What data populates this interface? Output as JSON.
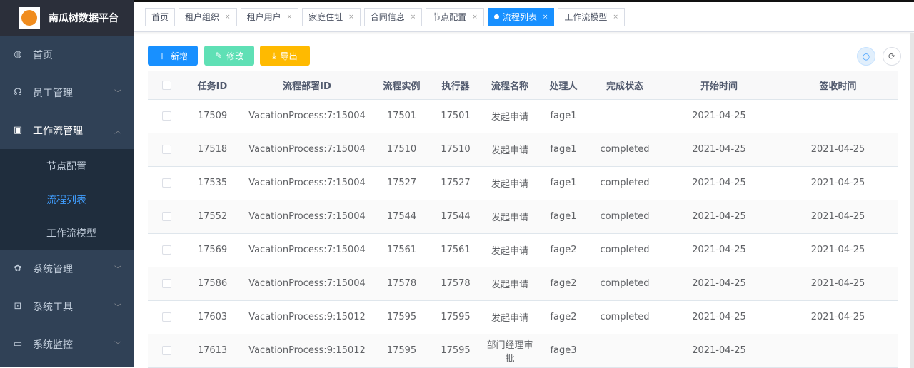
{
  "app": {
    "title": "南瓜树数据平台"
  },
  "sidebar": {
    "items": [
      {
        "label": "首页",
        "icon": "dashboard-icon",
        "expandable": false
      },
      {
        "label": "员工管理",
        "icon": "user-group-icon",
        "expandable": true
      },
      {
        "label": "工作流管理",
        "icon": "workflow-icon",
        "expandable": true,
        "expanded": true,
        "children": [
          {
            "label": "节点配置"
          },
          {
            "label": "流程列表",
            "active": true
          },
          {
            "label": "工作流模型"
          }
        ]
      },
      {
        "label": "系统管理",
        "icon": "gear-icon",
        "expandable": true
      },
      {
        "label": "系统工具",
        "icon": "toolbox-icon",
        "expandable": true
      },
      {
        "label": "系统监控",
        "icon": "monitor-icon",
        "expandable": true
      }
    ]
  },
  "tabs": [
    {
      "label": "首页"
    },
    {
      "label": "租户组织"
    },
    {
      "label": "租户用户"
    },
    {
      "label": "家庭住址"
    },
    {
      "label": "合同信息"
    },
    {
      "label": "节点配置"
    },
    {
      "label": "流程列表",
      "active": true
    },
    {
      "label": "工作流模型"
    }
  ],
  "toolbar": {
    "add": "新增",
    "edit": "修改",
    "export": "导出",
    "colors": {
      "add": "#1890ff",
      "edit": "#5fe0b5",
      "export": "#ffba00"
    }
  },
  "table": {
    "headers": [
      "任务ID",
      "流程部署ID",
      "流程实例",
      "执行器",
      "流程名称",
      "处理人",
      "完成状态",
      "开始时间",
      "签收时间"
    ],
    "rows": [
      [
        "17509",
        "VacationProcess:7:15004",
        "17501",
        "17501",
        "发起申请",
        "fage1",
        "",
        "2021-04-25",
        ""
      ],
      [
        "17518",
        "VacationProcess:7:15004",
        "17510",
        "17510",
        "发起申请",
        "fage1",
        "completed",
        "2021-04-25",
        "2021-04-25"
      ],
      [
        "17535",
        "VacationProcess:7:15004",
        "17527",
        "17527",
        "发起申请",
        "fage1",
        "completed",
        "2021-04-25",
        "2021-04-25"
      ],
      [
        "17552",
        "VacationProcess:7:15004",
        "17544",
        "17544",
        "发起申请",
        "fage1",
        "completed",
        "2021-04-25",
        "2021-04-25"
      ],
      [
        "17569",
        "VacationProcess:7:15004",
        "17561",
        "17561",
        "发起申请",
        "fage2",
        "completed",
        "2021-04-25",
        "2021-04-25"
      ],
      [
        "17586",
        "VacationProcess:7:15004",
        "17578",
        "17578",
        "发起申请",
        "fage2",
        "completed",
        "2021-04-25",
        "2021-04-25"
      ],
      [
        "17603",
        "VacationProcess:9:15012",
        "17595",
        "17595",
        "发起申请",
        "fage2",
        "completed",
        "2021-04-25",
        "2021-04-25"
      ],
      [
        "17613",
        "VacationProcess:9:15012",
        "17595",
        "17595",
        "部门经理审批",
        "fage3",
        "",
        "2021-04-25",
        ""
      ]
    ]
  }
}
